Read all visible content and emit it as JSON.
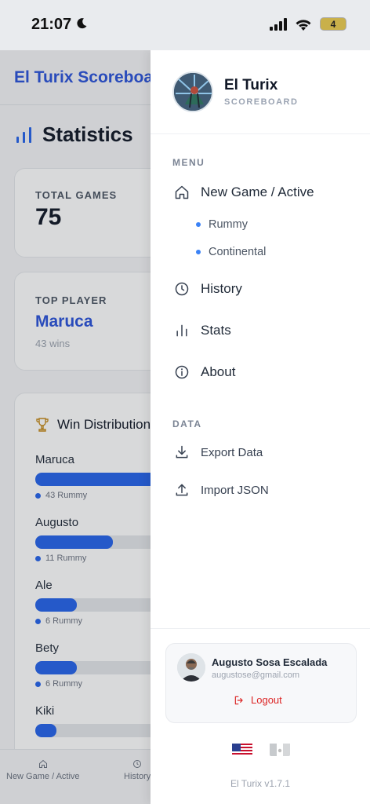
{
  "status_bar": {
    "time": "21:07",
    "battery": "4"
  },
  "background": {
    "app_title": "El Turix Scoreboard",
    "page_title": "Statistics",
    "total_games": {
      "label": "TOTAL GAMES",
      "value": "75"
    },
    "top_player": {
      "label": "TOP PLAYER",
      "name": "Maruca",
      "wins": "43 wins"
    },
    "win_distribution": {
      "title": "Win Distribution",
      "rows": [
        {
          "name": "Maruca",
          "fill": 0.57,
          "meta": "43 Rummy"
        },
        {
          "name": "Augusto",
          "fill": 0.26,
          "meta": "11 Rummy"
        },
        {
          "name": "Ale",
          "fill": 0.14,
          "meta": "6 Rummy"
        },
        {
          "name": "Bety",
          "fill": 0.14,
          "meta": "6 Rummy"
        },
        {
          "name": "Kiki",
          "fill": 0.07,
          "meta": ""
        }
      ]
    },
    "bottom_nav": {
      "new_game": "New Game / Active",
      "history": "History"
    }
  },
  "drawer": {
    "title": "El Turix",
    "subtitle": "SCOREBOARD",
    "menu_label": "MENU",
    "menu": {
      "new_game": "New Game / Active",
      "rummy": "Rummy",
      "continental": "Continental",
      "history": "History",
      "stats": "Stats",
      "about": "About"
    },
    "data_label": "DATA",
    "data": {
      "export": "Export Data",
      "import": "Import JSON"
    },
    "user": {
      "name": "Augusto Sosa Escalada",
      "email": "augustose@gmail.com",
      "logout": "Logout"
    },
    "version": "El Turix v1.7.1"
  },
  "colors": {
    "accent": "#2563eb",
    "brand_text": "#2a52d9",
    "logout": "#dc2626"
  }
}
